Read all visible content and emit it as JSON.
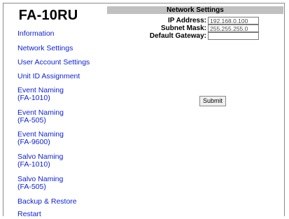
{
  "sidebar": {
    "device_title": "FA-10RU",
    "items": [
      {
        "label": "Information"
      },
      {
        "label": "Network Settings"
      },
      {
        "label": "User Account Settings"
      },
      {
        "label": "Unit ID Assignment"
      },
      {
        "label": "Event Naming\n(FA-1010)"
      },
      {
        "label": "Event Naming\n(FA-505)"
      },
      {
        "label": "Event Naming\n(FA-9600)"
      },
      {
        "label": "Salvo Naming\n(FA-1010)"
      },
      {
        "label": "Salvo Naming\n(FA-505)"
      },
      {
        "label": "Backup & Restore"
      },
      {
        "label": "Restart"
      }
    ]
  },
  "main": {
    "section_title": "Network Settings",
    "fields": [
      {
        "label": "IP Address:",
        "value": "192.168.0.100"
      },
      {
        "label": "Subnet Mask:",
        "value": "255.255.255.0"
      },
      {
        "label": "Default Gateway:",
        "value": ""
      }
    ],
    "submit_label": "Submit"
  },
  "colors": {
    "link": "#0a1fd8",
    "header_bg": "#c0c0c0",
    "border": "#8a8a8a"
  }
}
